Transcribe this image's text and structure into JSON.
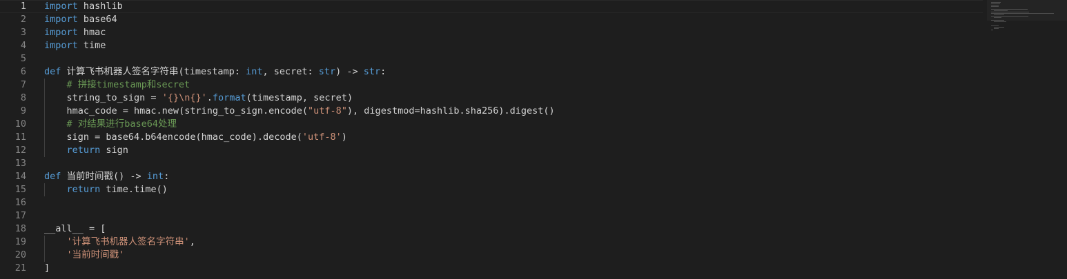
{
  "editor": {
    "language": "python",
    "current_line": 1,
    "lines": [
      [
        {
          "t": "kw",
          "v": "import"
        },
        {
          "t": "pl",
          "v": " hashlib"
        }
      ],
      [
        {
          "t": "kw",
          "v": "import"
        },
        {
          "t": "pl",
          "v": " base64"
        }
      ],
      [
        {
          "t": "kw",
          "v": "import"
        },
        {
          "t": "pl",
          "v": " hmac"
        }
      ],
      [
        {
          "t": "kw",
          "v": "import"
        },
        {
          "t": "pl",
          "v": " time"
        }
      ],
      [],
      [
        {
          "t": "kw",
          "v": "def"
        },
        {
          "t": "pl",
          "v": " 计算飞书机器人签名字符串(timestamp: "
        },
        {
          "t": "kw",
          "v": "int"
        },
        {
          "t": "pl",
          "v": ", secret: "
        },
        {
          "t": "kw",
          "v": "str"
        },
        {
          "t": "pl",
          "v": ") -> "
        },
        {
          "t": "kw",
          "v": "str"
        },
        {
          "t": "pl",
          "v": ":"
        }
      ],
      [
        {
          "t": "pl",
          "v": "    "
        },
        {
          "t": "cm",
          "v": "# 拼接timestamp和secret"
        }
      ],
      [
        {
          "t": "pl",
          "v": "    string_to_sign = "
        },
        {
          "t": "str",
          "v": "'{}\\n{}'"
        },
        {
          "t": "pl",
          "v": "."
        },
        {
          "t": "kw",
          "v": "format"
        },
        {
          "t": "pl",
          "v": "(timestamp, secret)"
        }
      ],
      [
        {
          "t": "pl",
          "v": "    hmac_code = hmac.new(string_to_sign.encode("
        },
        {
          "t": "str",
          "v": "\"utf-8\""
        },
        {
          "t": "pl",
          "v": "), digestmod=hashlib.sha256).digest()"
        }
      ],
      [
        {
          "t": "pl",
          "v": "    "
        },
        {
          "t": "cm",
          "v": "# 对结果进行base64处理"
        }
      ],
      [
        {
          "t": "pl",
          "v": "    sign = base64.b64encode(hmac_code).decode("
        },
        {
          "t": "str",
          "v": "'utf-8'"
        },
        {
          "t": "pl",
          "v": ")"
        }
      ],
      [
        {
          "t": "pl",
          "v": "    "
        },
        {
          "t": "kw",
          "v": "return"
        },
        {
          "t": "pl",
          "v": " sign"
        }
      ],
      [],
      [
        {
          "t": "kw",
          "v": "def"
        },
        {
          "t": "pl",
          "v": " 当前时间戳() -> "
        },
        {
          "t": "kw",
          "v": "int"
        },
        {
          "t": "pl",
          "v": ":"
        }
      ],
      [
        {
          "t": "pl",
          "v": "    "
        },
        {
          "t": "kw",
          "v": "return"
        },
        {
          "t": "pl",
          "v": " time.time()"
        }
      ],
      [],
      [],
      [
        {
          "t": "pl",
          "v": "__all__ = ["
        }
      ],
      [
        {
          "t": "pl",
          "v": "    "
        },
        {
          "t": "str",
          "v": "'计算飞书机器人签名字符串'"
        },
        {
          "t": "pl",
          "v": ","
        }
      ],
      [
        {
          "t": "pl",
          "v": "    "
        },
        {
          "t": "str",
          "v": "'当前时间戳'"
        }
      ],
      [
        {
          "t": "pl",
          "v": "]"
        }
      ]
    ],
    "indent_guides": [
      7,
      8,
      9,
      10,
      11,
      12,
      15,
      19,
      20
    ]
  },
  "colors": {
    "background": "#1e1e1e",
    "keyword": "#569cd6",
    "string": "#ce9178",
    "comment": "#6a9955",
    "text": "#d4d4d4",
    "line_number": "#858585"
  }
}
